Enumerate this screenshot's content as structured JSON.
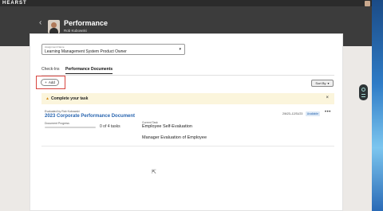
{
  "topbar": {
    "brand": "HEARST"
  },
  "header": {
    "title": "Performance",
    "subtitle": "Rob Kubowski"
  },
  "assignment": {
    "label": "Assignment Name",
    "value": "Learning Management System Product Owner"
  },
  "tabs": [
    {
      "label": "Check-Ins",
      "active": false
    },
    {
      "label": "Performance Documents",
      "active": true
    }
  ],
  "toolbar": {
    "add_label": "Add",
    "sort_label": "Sort By"
  },
  "banner": {
    "text": "Complete your task"
  },
  "document": {
    "evaluated_label": "Evaluated by Rob Kubowski",
    "title": "2023 Corporate Performance Document",
    "progress_label": "Document Progress",
    "progress_fraction": 0,
    "progress_text": "0 of 4 tasks",
    "current_task_label": "Current Task",
    "current_task": "Employee Self-Evaluation",
    "next_task": "Manager Evaluation of Employee",
    "date": "2/6/23–12/31/23",
    "status": "Available"
  },
  "colors": {
    "accent": "#2a66b0",
    "banner_bg": "#fbf5dc",
    "highlight": "#d8453f",
    "header_bg": "#3c3c3c"
  }
}
